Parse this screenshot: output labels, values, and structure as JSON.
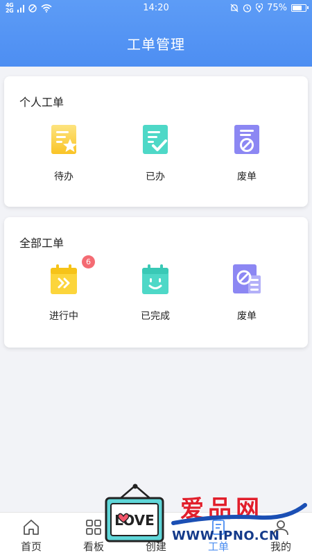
{
  "status_bar": {
    "network": "4G\n2G",
    "time": "14:20",
    "battery": "75%",
    "battery_level": 0.75
  },
  "header": {
    "title": "工单管理"
  },
  "personal": {
    "title": "个人工单",
    "tiles": [
      {
        "label": "待办",
        "icon": "todo-doc-star-icon"
      },
      {
        "label": "已办",
        "icon": "done-doc-check-icon"
      },
      {
        "label": "废单",
        "icon": "void-doc-icon"
      }
    ]
  },
  "all": {
    "title": "全部工单",
    "tiles": [
      {
        "label": "进行中",
        "icon": "in-progress-calendar-icon",
        "badge": "6"
      },
      {
        "label": "已完成",
        "icon": "completed-calendar-icon"
      },
      {
        "label": "废单",
        "icon": "void-list-icon"
      }
    ]
  },
  "tabbar": {
    "tabs": [
      {
        "label": "首页",
        "icon": "home-icon",
        "active": false
      },
      {
        "label": "看板",
        "icon": "dashboard-icon",
        "active": false
      },
      {
        "label": "创建",
        "icon": "create-icon",
        "active": false
      },
      {
        "label": "工单",
        "icon": "workorder-icon",
        "active": true
      },
      {
        "label": "我的",
        "icon": "profile-icon",
        "active": false
      }
    ]
  },
  "watermark": {
    "sign": "LOVE",
    "cn": "爱品网",
    "url": "WWW.IPNO.CN"
  },
  "colors": {
    "header": "#4d8ef2",
    "yellow": "#fcd53b",
    "teal": "#4ed8c7",
    "purple": "#8c87f3",
    "badge": "#f46b73",
    "active_tab": "#4a8df0"
  }
}
